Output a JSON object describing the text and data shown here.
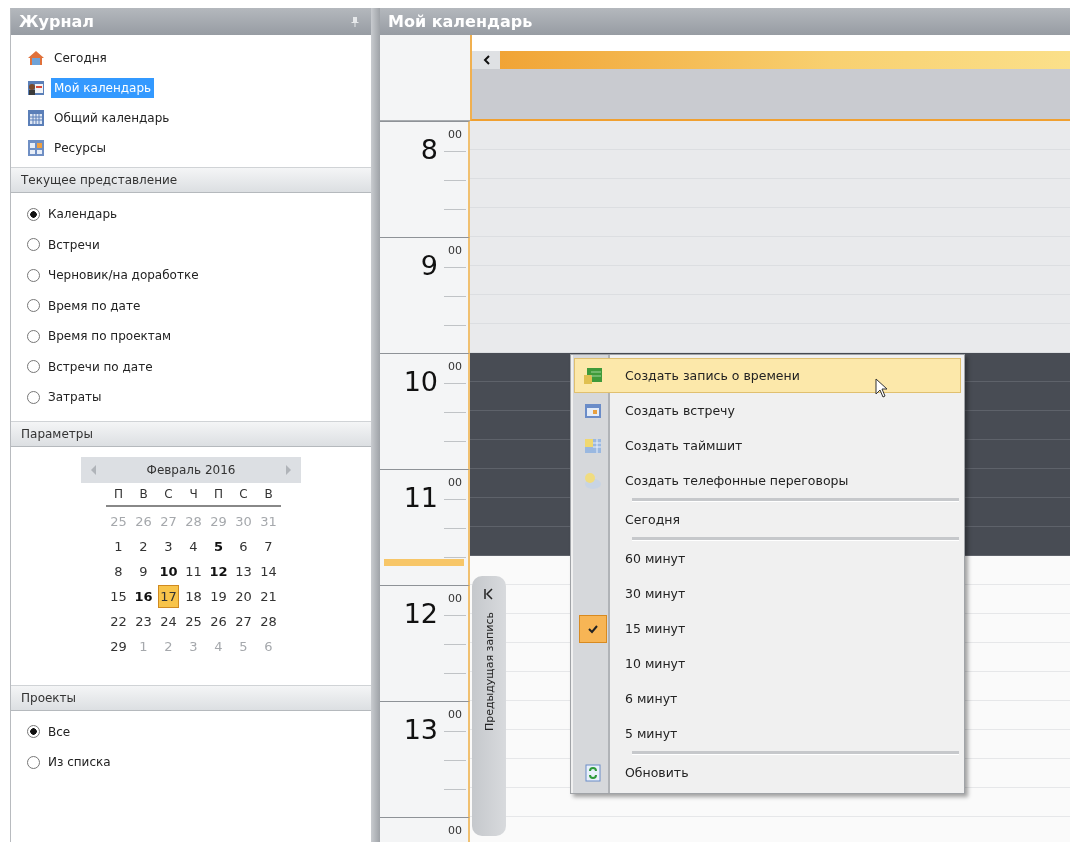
{
  "left_panel": {
    "title": "Журнал",
    "nav": [
      {
        "label": "Сегодня",
        "selected": false
      },
      {
        "label": "Мой календарь",
        "selected": true
      },
      {
        "label": "Общий календарь",
        "selected": false
      },
      {
        "label": "Ресурсы",
        "selected": false
      }
    ],
    "view_section": {
      "title": "Текущее представление",
      "options": [
        {
          "label": "Календарь",
          "selected": true
        },
        {
          "label": "Встречи",
          "selected": false
        },
        {
          "label": "Черновик/на доработке",
          "selected": false
        },
        {
          "label": "Время по дате",
          "selected": false
        },
        {
          "label": "Время по проектам",
          "selected": false
        },
        {
          "label": "Встречи по дате",
          "selected": false
        },
        {
          "label": "Затраты",
          "selected": false
        }
      ]
    },
    "params_section": {
      "title": "Параметры",
      "calendar": {
        "month": "Февраль 2016",
        "weekdays": [
          "П",
          "В",
          "С",
          "Ч",
          "П",
          "С",
          "В"
        ],
        "weeks": [
          [
            {
              "day": "25",
              "other_month": true,
              "bold": false,
              "selected": false
            },
            {
              "day": "26",
              "other_month": true,
              "bold": false,
              "selected": false
            },
            {
              "day": "27",
              "other_month": true,
              "bold": false,
              "selected": false
            },
            {
              "day": "28",
              "other_month": true,
              "bold": false,
              "selected": false
            },
            {
              "day": "29",
              "other_month": true,
              "bold": false,
              "selected": false
            },
            {
              "day": "30",
              "other_month": true,
              "bold": false,
              "selected": false
            },
            {
              "day": "31",
              "other_month": true,
              "bold": false,
              "selected": false
            }
          ],
          [
            {
              "day": "1",
              "other_month": false,
              "bold": false,
              "selected": false
            },
            {
              "day": "2",
              "other_month": false,
              "bold": false,
              "selected": false
            },
            {
              "day": "3",
              "other_month": false,
              "bold": false,
              "selected": false
            },
            {
              "day": "4",
              "other_month": false,
              "bold": false,
              "selected": false
            },
            {
              "day": "5",
              "other_month": false,
              "bold": true,
              "selected": false
            },
            {
              "day": "6",
              "other_month": false,
              "bold": false,
              "selected": false
            },
            {
              "day": "7",
              "other_month": false,
              "bold": false,
              "selected": false
            }
          ],
          [
            {
              "day": "8",
              "other_month": false,
              "bold": false,
              "selected": false
            },
            {
              "day": "9",
              "other_month": false,
              "bold": false,
              "selected": false
            },
            {
              "day": "10",
              "other_month": false,
              "bold": true,
              "selected": false
            },
            {
              "day": "11",
              "other_month": false,
              "bold": false,
              "selected": false
            },
            {
              "day": "12",
              "other_month": false,
              "bold": true,
              "selected": false
            },
            {
              "day": "13",
              "other_month": false,
              "bold": false,
              "selected": false
            },
            {
              "day": "14",
              "other_month": false,
              "bold": false,
              "selected": false
            }
          ],
          [
            {
              "day": "15",
              "other_month": false,
              "bold": false,
              "selected": false
            },
            {
              "day": "16",
              "other_month": false,
              "bold": true,
              "selected": false
            },
            {
              "day": "17",
              "other_month": false,
              "bold": false,
              "selected": true
            },
            {
              "day": "18",
              "other_month": false,
              "bold": false,
              "selected": false
            },
            {
              "day": "19",
              "other_month": false,
              "bold": false,
              "selected": false
            },
            {
              "day": "20",
              "other_month": false,
              "bold": false,
              "selected": false
            },
            {
              "day": "21",
              "other_month": false,
              "bold": false,
              "selected": false
            }
          ],
          [
            {
              "day": "22",
              "other_month": false,
              "bold": false,
              "selected": false
            },
            {
              "day": "23",
              "other_month": false,
              "bold": false,
              "selected": false
            },
            {
              "day": "24",
              "other_month": false,
              "bold": false,
              "selected": false
            },
            {
              "day": "25",
              "other_month": false,
              "bold": false,
              "selected": false
            },
            {
              "day": "26",
              "other_month": false,
              "bold": false,
              "selected": false
            },
            {
              "day": "27",
              "other_month": false,
              "bold": false,
              "selected": false
            },
            {
              "day": "28",
              "other_month": false,
              "bold": false,
              "selected": false
            }
          ],
          [
            {
              "day": "29",
              "other_month": false,
              "bold": false,
              "selected": false
            },
            {
              "day": "1",
              "other_month": true,
              "bold": false,
              "selected": false
            },
            {
              "day": "2",
              "other_month": true,
              "bold": false,
              "selected": false
            },
            {
              "day": "3",
              "other_month": true,
              "bold": false,
              "selected": false
            },
            {
              "day": "4",
              "other_month": true,
              "bold": false,
              "selected": false
            },
            {
              "day": "5",
              "other_month": true,
              "bold": false,
              "selected": false
            },
            {
              "day": "6",
              "other_month": true,
              "bold": false,
              "selected": false
            }
          ]
        ]
      }
    },
    "projects_section": {
      "title": "Проекты",
      "options": [
        {
          "label": "Все",
          "selected": true
        },
        {
          "label": "Из списка",
          "selected": false
        }
      ]
    }
  },
  "calendar_view": {
    "title": "Мой календарь",
    "hours": [
      {
        "hour": "8",
        "minutes": "00",
        "now": false,
        "slots": [
          {
            "selected": false,
            "work": false
          },
          {
            "selected": false,
            "work": false
          },
          {
            "selected": false,
            "work": false
          },
          {
            "selected": false,
            "work": false
          }
        ]
      },
      {
        "hour": "9",
        "minutes": "00",
        "now": false,
        "slots": [
          {
            "selected": false,
            "work": false
          },
          {
            "selected": false,
            "work": false
          },
          {
            "selected": false,
            "work": false
          },
          {
            "selected": false,
            "work": false
          }
        ]
      },
      {
        "hour": "10",
        "minutes": "00",
        "now": false,
        "slots": [
          {
            "selected": true,
            "work": true
          },
          {
            "selected": true,
            "work": true
          },
          {
            "selected": true,
            "work": true
          },
          {
            "selected": true,
            "work": true
          }
        ]
      },
      {
        "hour": "11",
        "minutes": "00",
        "now": true,
        "slots": [
          {
            "selected": true,
            "work": true
          },
          {
            "selected": true,
            "work": true
          },
          {
            "selected": true,
            "work": true
          },
          {
            "selected": false,
            "work": true
          }
        ]
      },
      {
        "hour": "12",
        "minutes": "00",
        "now": false,
        "slots": [
          {
            "selected": false,
            "work": true
          },
          {
            "selected": false,
            "work": true
          },
          {
            "selected": false,
            "work": true
          },
          {
            "selected": false,
            "work": true
          }
        ]
      },
      {
        "hour": "13",
        "minutes": "00",
        "now": false,
        "slots": [
          {
            "selected": false,
            "work": true
          },
          {
            "selected": false,
            "work": true
          },
          {
            "selected": false,
            "work": true
          },
          {
            "selected": false,
            "work": true
          }
        ]
      },
      {
        "minutes": "00",
        "now": false,
        "slots": [
          {
            "selected": false,
            "work": true
          }
        ]
      }
    ],
    "prev_tab": {
      "label": "Предыдущая запись"
    },
    "context_menu": {
      "items": [
        {
          "kind": "item",
          "label": "Создать запись о времени",
          "selected": true,
          "checked": false
        },
        {
          "kind": "item",
          "label": "Создать встречу",
          "selected": false,
          "checked": false
        },
        {
          "kind": "item",
          "label": "Создать таймшит",
          "selected": false,
          "checked": false
        },
        {
          "kind": "item",
          "label": "Создать телефонные переговоры",
          "selected": false,
          "checked": false
        },
        {
          "kind": "separator"
        },
        {
          "kind": "item",
          "label": "Сегодня",
          "selected": false,
          "checked": false
        },
        {
          "kind": "separator"
        },
        {
          "kind": "item",
          "label": "60 минут",
          "selected": false,
          "checked": false
        },
        {
          "kind": "item",
          "label": "30 минут",
          "selected": false,
          "checked": false
        },
        {
          "kind": "item",
          "label": "15 минут",
          "selected": false,
          "checked": true
        },
        {
          "kind": "item",
          "label": "10 минут",
          "selected": false,
          "checked": false
        },
        {
          "kind": "item",
          "label": "6 минут",
          "selected": false,
          "checked": false
        },
        {
          "kind": "item",
          "label": "5 минут",
          "selected": false,
          "checked": false
        },
        {
          "kind": "separator"
        },
        {
          "kind": "item",
          "label": "Обновить",
          "selected": false,
          "checked": false
        }
      ]
    }
  }
}
